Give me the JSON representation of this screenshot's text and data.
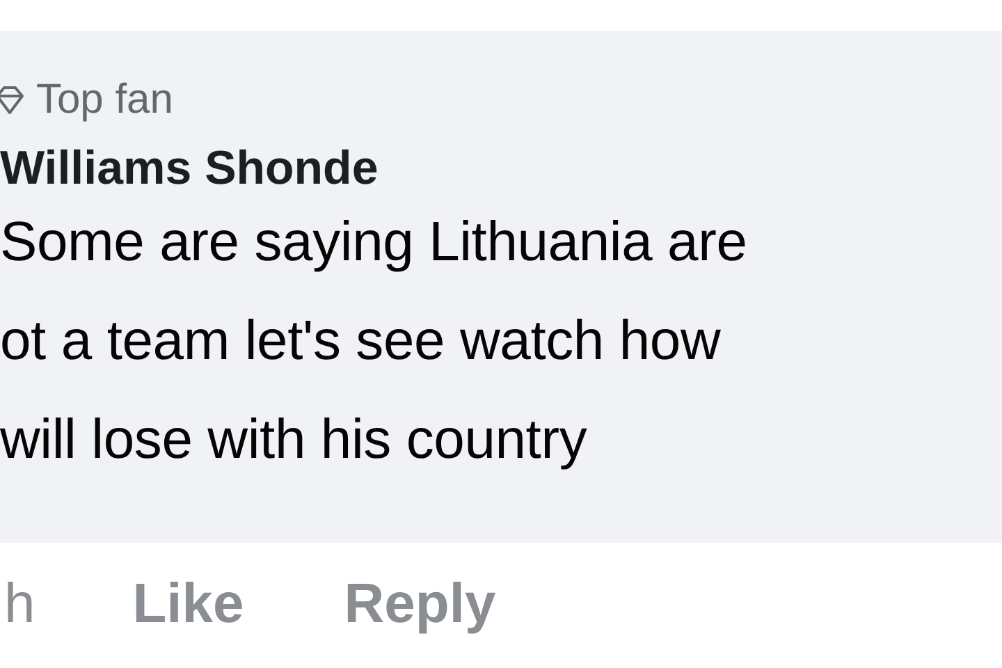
{
  "comment": {
    "badge": "Top fan",
    "author": "Williams Shonde",
    "body_lines": [
      "Some are saying Lithuania are",
      "ot a team let's see watch how",
      "will lose with his country"
    ]
  },
  "actions": [
    {
      "kind": "time",
      "label": "h"
    },
    {
      "kind": "link",
      "label": "Like"
    },
    {
      "kind": "link",
      "label": "Reply"
    }
  ]
}
